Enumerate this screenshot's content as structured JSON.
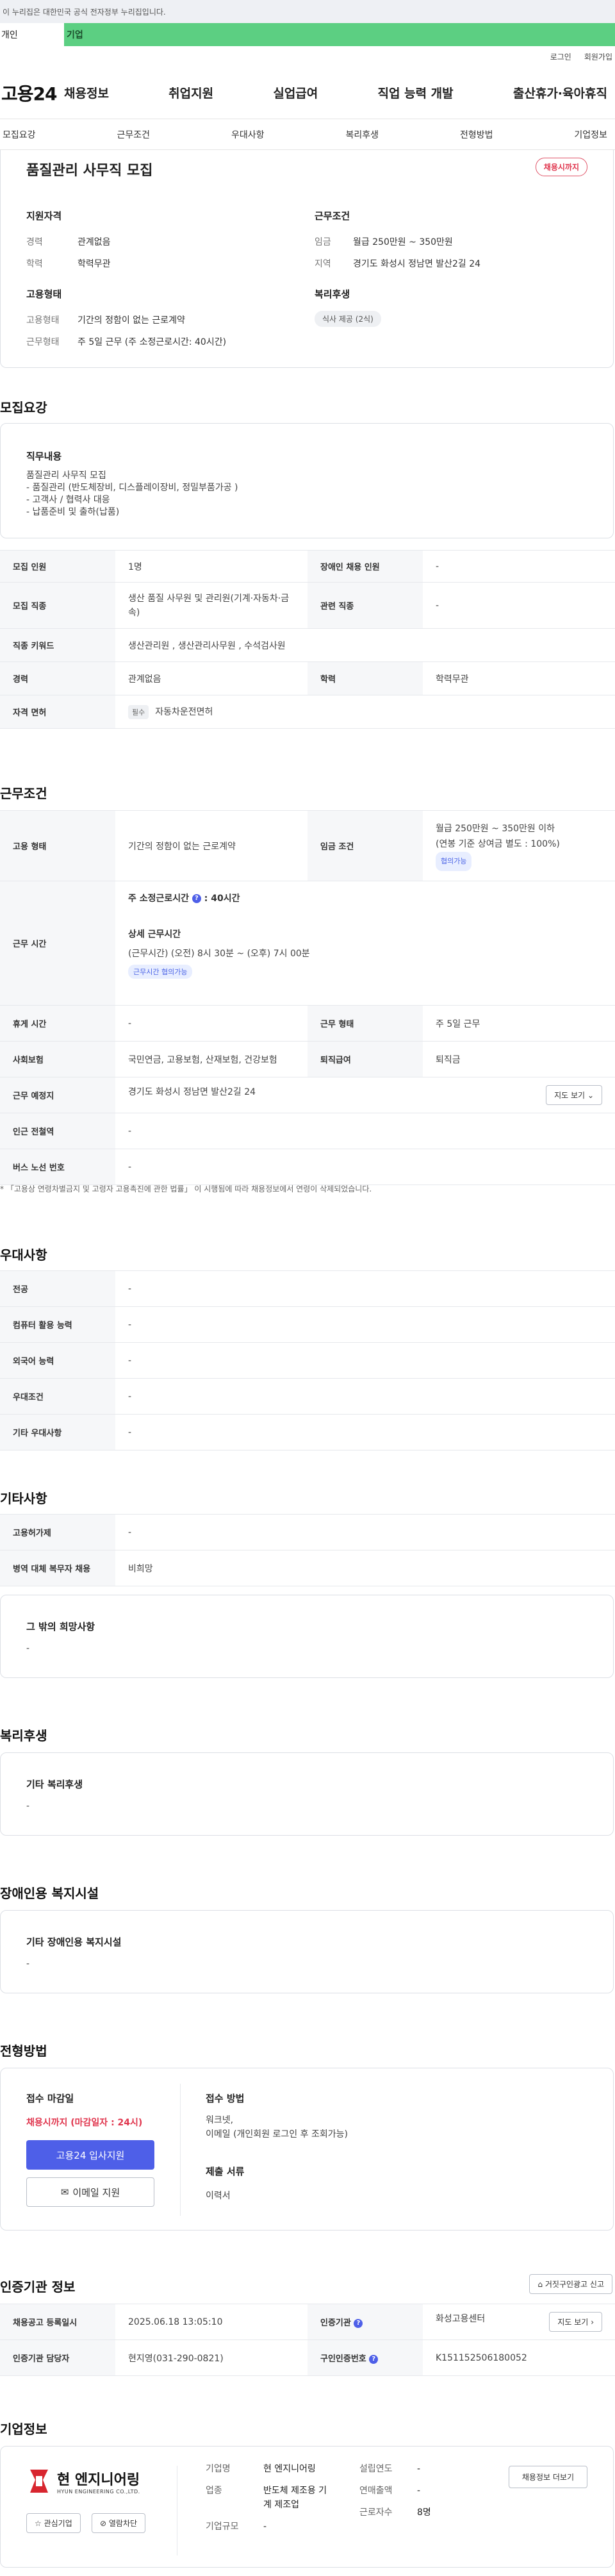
{
  "gov_banner": "이 누리집은 대한민국 공식 전자정부 누리집입니다.",
  "segment_tabs": {
    "person": "개인",
    "biz": "기업"
  },
  "util": {
    "login": "로그인",
    "join": "회원가입"
  },
  "logo": "고용24",
  "gnb": [
    "채용정보",
    "취업지원",
    "실업급여",
    "직업 능력 개발",
    "출산휴가·육아휴직"
  ],
  "subnav": [
    "모집요강",
    "근무조건",
    "우대사항",
    "복리후생",
    "전형방법",
    "기업정보"
  ],
  "hero": {
    "title": "품질관리 사무직 모집",
    "status": "채용시까지",
    "qual_head": "지원자격",
    "career_k": "경력",
    "career_v": "관계없음",
    "edu_k": "학력",
    "edu_v": "학력무관",
    "cond_head": "근무조건",
    "wage_k": "임금",
    "wage_v": "월급 250만원 ~ 350만원",
    "region_k": "지역",
    "region_v": "경기도 화성시 정남면 발산2길 24",
    "emp_head": "고용형태",
    "emptype_k": "고용형태",
    "emptype_v": "기간의 정함이 없는 근로계약",
    "workform_k": "근무형태",
    "workform_v": "주 5일 근무 (주 소정근로시간: 40시간)",
    "welfare_head": "복리후생",
    "welfare_chip": "식사 제공 (2식)"
  },
  "recruit": {
    "title": "모집요강",
    "duty_head": "직무내용",
    "duty_lines": [
      "품질관리 사무직 모집",
      "- 품질관리 (반도체장비, 디스플레이장비, 정밀부품가공 )",
      "- 고객사 / 협력사 대응",
      "- 납품준비 및 출하(납품)"
    ],
    "rows": {
      "headcount_k": "모집 인원",
      "headcount_v": "1명",
      "disabled_k": "장애인 채용 인원",
      "disabled_v": "-",
      "job_k": "모집 직종",
      "job_v1": "생산 품질 사무원 및 관리원(기계·자동차·금",
      "job_v2": "속)",
      "related_k": "관련 직종",
      "related_v": "-",
      "keyword_k": "직종 키워드",
      "keyword_v": "생산관리원 , 생산관리사무원 , 수석검사원",
      "career_k": "경력",
      "career_v": "관계없음",
      "edu_k": "학력",
      "edu_v": "학력무관",
      "license_k": "자격 면허",
      "license_badge": "필수",
      "license_v": "자동차운전면허"
    }
  },
  "conditions": {
    "title": "근무조건",
    "emptype_k": "고용 형태",
    "emptype_v": "기간의 정함이 없는 근로계약",
    "wage_k": "임금 조건",
    "wage_v1": "월급 250만원 ~ 350만원 이하",
    "wage_v2": "(연봉 기준 상여금 별도 : 100%)",
    "wage_badge": "협의가능",
    "hours_k": "근무 시간",
    "hours_std_label": "주 소정근로시간",
    "hours_std_v": ": 40시간",
    "hours_detail_head": "상세 근무시간",
    "hours_detail_v": "(근무시간) (오전) 8시 30분 ~ (오후) 7시 00분",
    "hours_badge": "근무시간 협의가능",
    "holiday_k": "휴게 시간",
    "holiday_v": "-",
    "workform_k": "근무 형태",
    "workform_v": "주 5일 근무",
    "insurance_k": "사회보험",
    "insurance_v": "국민연금, 고용보험, 산재보험, 건강보험",
    "severance_k": "퇴직급여",
    "severance_v": "퇴직금",
    "place_k": "근무 예정지",
    "place_v": "경기도 화성시 정남면 발산2길 24",
    "map_btn": "지도 보기",
    "station_k": "인근 전철역",
    "station_v": "-",
    "bus_k": "버스 노선 번호",
    "bus_v": "-",
    "note": "* 「고용상 연령차별금지 및 고령자 고용촉진에 관한 법률」 이 시행됨에 따라 채용정보에서 연령이 삭제되었습니다."
  },
  "preference": {
    "title": "우대사항",
    "major_k": "전공",
    "major_v": "-",
    "computer_k": "컴퓨터 활용 능력",
    "computer_v": "-",
    "language_k": "외국어 능력",
    "language_v": "-",
    "pref_k": "우대조건",
    "pref_v": "-",
    "etc_k": "기타 우대사항",
    "etc_v": "-"
  },
  "other": {
    "title": "기타사항",
    "permit_k": "고용허가제",
    "permit_v": "-",
    "military_k": "병역 대체 복무자 채용",
    "military_v": "비희망",
    "wish_head": "그 밖의 희망사항",
    "wish_v": "-"
  },
  "welfare": {
    "title": "복리후생",
    "head": "기타 복리후생",
    "v": "-"
  },
  "accessibility": {
    "title": "장애인용 복지시설",
    "head": "기타 장애인용 복지시설",
    "v": "-"
  },
  "process": {
    "title": "전형방법",
    "deadline_head": "접수 마감일",
    "deadline_v": "채용시까지 (마감일자 : 24시)",
    "apply_btn": "고용24 입사지원",
    "email_btn": "이메일 지원",
    "method_head": "접수 방법",
    "method_v1": "워크넷,",
    "method_v2": "이메일 (개인회원 로그인 후 조회가능)",
    "docs_head": "제출 서류",
    "docs_v": "이력서"
  },
  "agency": {
    "title": "인증기관 정보",
    "report_btn": "거짓구인광고 신고",
    "reg_k": "채용공고 등록일시",
    "reg_v": "2025.06.18 13:05:10",
    "org_k": "인증기관",
    "org_v": "화성고용센터",
    "map_btn": "지도 보기",
    "manager_k": "인증기관 담당자",
    "manager_v": "현지영(031-290-0821)",
    "no_k": "구인인증번호",
    "no_v": "K151152506180052"
  },
  "company": {
    "title": "기업정보",
    "logo_kr": "현 엔지니어링",
    "logo_en": "HYUN ENGINEERING CO.,LTD.",
    "fav_btn": "관심기업",
    "block_btn": "열람차단",
    "name_k": "기업명",
    "name_v": "현 엔지니어링",
    "industry_k": "업종",
    "industry_v1": "반도체 제조용 기",
    "industry_v2": "계 제조업",
    "size_k": "기업규모",
    "size_v": "-",
    "founded_k": "설립연도",
    "founded_v": "-",
    "sales_k": "연매출액",
    "sales_v": "-",
    "employees_k": "근로자수",
    "employees_v": "8명",
    "more_btn": "채용정보 더보기"
  }
}
